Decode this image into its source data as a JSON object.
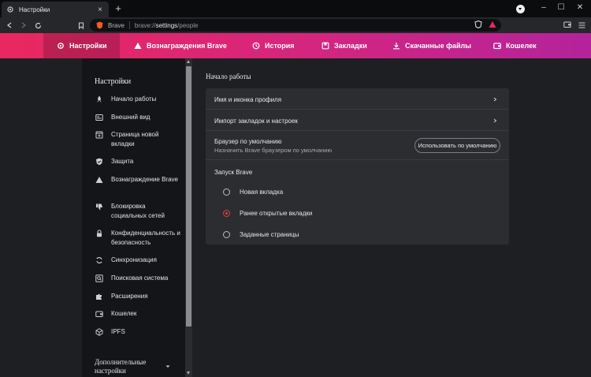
{
  "window": {
    "tab_title": "Настройки",
    "controls": [
      "minimize",
      "maximize",
      "close"
    ]
  },
  "toolbar": {
    "site_name": "Brave",
    "url_prefix": "brave://",
    "url_bold": "settings",
    "url_suffix": "/people"
  },
  "navbar": {
    "items": [
      {
        "label": "Настройки",
        "icon": "gear-icon",
        "active": true
      },
      {
        "label": "Вознаграждения Brave",
        "icon": "triangle-icon"
      },
      {
        "label": "История",
        "icon": "history-icon"
      },
      {
        "label": "Закладки",
        "icon": "bookmarks-icon"
      },
      {
        "label": "Скачанные файлы",
        "icon": "download-icon"
      },
      {
        "label": "Кошелек",
        "icon": "wallet-icon"
      }
    ]
  },
  "sidebar": {
    "title": "Настройки",
    "items": [
      {
        "label": "Начало работы",
        "icon": "rocket-icon"
      },
      {
        "label": "Внешний вид",
        "icon": "appearance-icon"
      },
      {
        "label": "Страница новой вкладки",
        "icon": "new-tab-icon"
      },
      {
        "label": "Защита",
        "icon": "shield-icon"
      },
      {
        "label": "Вознаграждение Brave",
        "icon": "rewards-triangle-icon"
      },
      {
        "label": "Блокировка социальных сетей",
        "icon": "thumbs-down-icon"
      },
      {
        "label": "Конфиденциальность и безопасность",
        "icon": "lock-icon"
      },
      {
        "label": "Синхронизация",
        "icon": "sync-icon"
      },
      {
        "label": "Поисковая система",
        "icon": "search-icon"
      },
      {
        "label": "Расширения",
        "icon": "puzzle-icon"
      },
      {
        "label": "Кошелек",
        "icon": "wallet-icon"
      },
      {
        "label": "IPFS",
        "icon": "cube-icon"
      }
    ],
    "advanced": "Дополнительные настройки"
  },
  "main": {
    "section_title": "Начало работы",
    "rows": {
      "profile": "Имя и иконка профиля",
      "import": "Импорт закладок и настроек",
      "default_title": "Браузер по умолчанию",
      "default_sub": "Назначить Brave браузером по умолчанию",
      "default_button": "Использовать по умолчанию"
    },
    "launch": {
      "title": "Запуск Brave",
      "options": [
        {
          "label": "Новая вкладка",
          "selected": false
        },
        {
          "label": "Ранее открытые вкладки",
          "selected": true
        },
        {
          "label": "Заданные страницы",
          "selected": false
        }
      ]
    }
  },
  "colors": {
    "nav_gradient_start": "#e8285f",
    "nav_gradient_end": "#b3239c",
    "radio_selected": "#e0413c",
    "background": "#1e1f22",
    "card": "#2c2d31"
  }
}
